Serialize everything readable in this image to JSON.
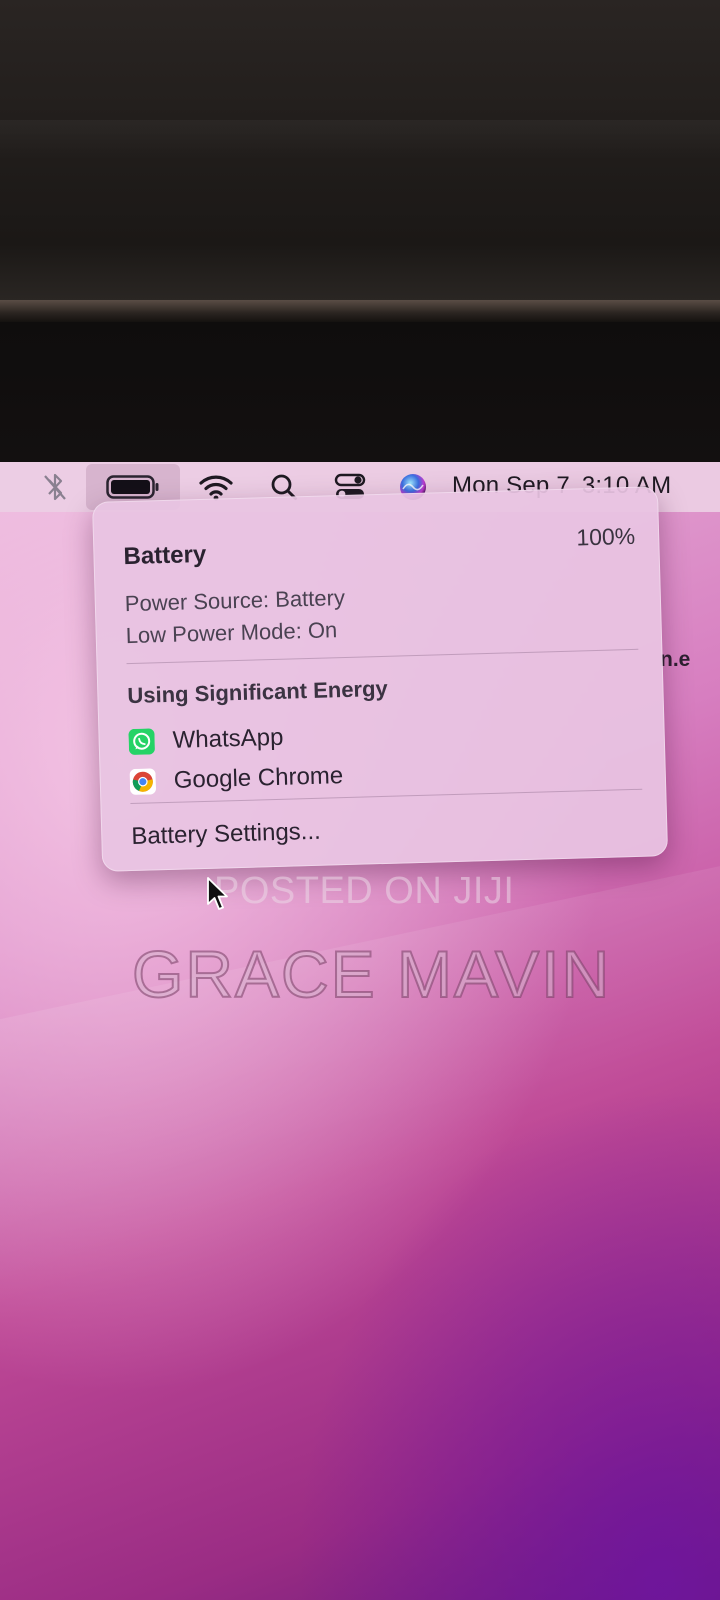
{
  "menubar": {
    "icons": [
      "bluetooth-off-icon",
      "battery-icon",
      "wifi-icon",
      "search-icon",
      "control-center-icon",
      "siri-icon"
    ],
    "clock": {
      "date": "Mon Sep 7",
      "time": "3:10 AM"
    },
    "battery_level": 1.0
  },
  "battery_menu": {
    "title": "Battery",
    "percent": "100%",
    "power_source": "Power Source: Battery",
    "low_power_mode": "Low Power Mode: On",
    "energy_heading": "Using Significant Energy",
    "apps": [
      {
        "name": "WhatsApp",
        "icon": "whatsapp-icon"
      },
      {
        "name": "Google Chrome",
        "icon": "chrome-icon"
      }
    ],
    "settings_label": "Battery Settings..."
  },
  "background_fragment": "n.e",
  "watermark": {
    "line1": "POSTED ON JIJI",
    "line2": "GRACE MAVIN"
  },
  "colors": {
    "wallpaper_light": "#e9b7dc",
    "wallpaper_dark": "#6a1a7a",
    "menu_bg": "#e8c4e2",
    "whatsapp_green": "#25d366"
  }
}
